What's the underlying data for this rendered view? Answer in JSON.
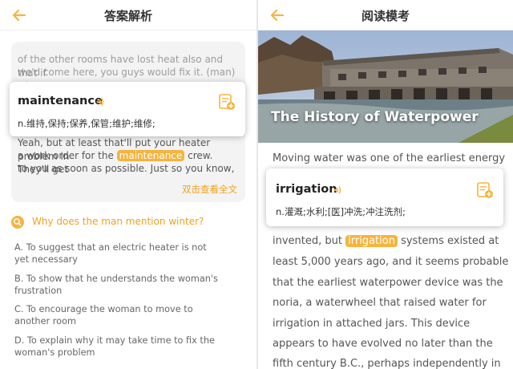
{
  "left": {
    "header": {
      "title": "答案解析"
    },
    "passage": {
      "line1": "of the other rooms have lost heat also and that if",
      "line2": "we'd come here, you guys would fix it. (man) Oh,",
      "line3": "Yeah, but at least that'll put your heater problem in",
      "line4_pre": "a work order for the",
      "line4_highlight": "maintenance",
      "line4_post": "crew. They'll get",
      "line5": "to you as soon as possible. Just so you know,",
      "view_full": "双击查看全文"
    },
    "popup": {
      "word": "maintenance",
      "definition": "n.维持,保持;保养,保管;维护;维修;"
    },
    "question": {
      "text": "Why does the man mention winter?",
      "options": [
        "A. To suggest that an electric heater is not yet necessary",
        "B. To show that he understands the woman's frustration",
        "C. To encourage the woman to move to another room",
        "D. To explain why it may take time to fix the woman's problem"
      ]
    }
  },
  "right": {
    "header": {
      "title": "阅读模考"
    },
    "hero": {
      "title": "The History of Waterpower"
    },
    "article": {
      "line1": "Moving water was one of the earliest energy",
      "line2_pre": "invented, but",
      "line2_highlight": "irrigation",
      "line2_post": "systems existed at",
      "line3": "least 5,000 years ago, and it seems probable",
      "line4": "that the earliest waterpower device was the",
      "line5": "noria, a waterwheel that raised water for",
      "line6": "irrigation in attached jars. This device",
      "line7": "appears to have evolved no later than the",
      "line8": "fifth century B.C., perhaps independently in"
    },
    "popup": {
      "word": "irrigation",
      "definition": "n.灌溉;水利;[医]冲洗;冲注洗剂;"
    }
  },
  "colors": {
    "accent": "#f5b43f",
    "accent_text": "#f0a21b"
  },
  "icons": [
    "back-arrow-icon",
    "sound-icon",
    "add-note-icon",
    "search-icon"
  ]
}
